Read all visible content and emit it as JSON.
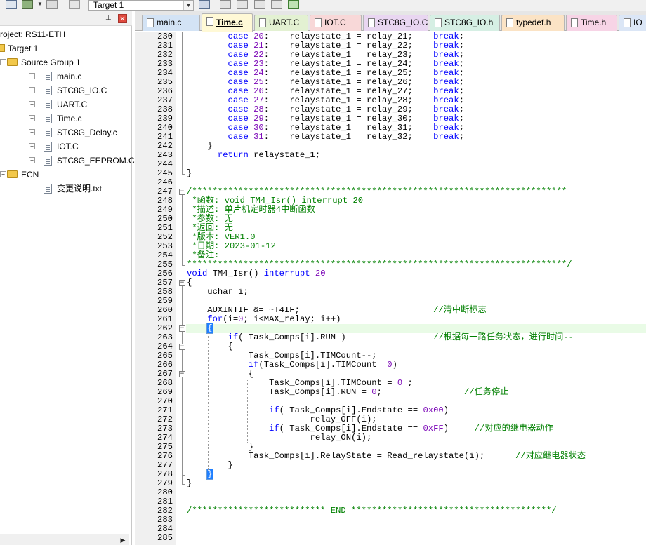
{
  "toolbar": {
    "target_select_value": "Target 1"
  },
  "project_panel": {
    "pin_glyph": "⊥",
    "close_glyph": "✕",
    "tree": [
      {
        "label": "roject: RS11-ETH",
        "kind": "project",
        "indent": 0
      },
      {
        "label": "Target 1",
        "kind": "target",
        "indent": 1
      },
      {
        "label": "Source Group 1",
        "kind": "folder",
        "indent": 2
      },
      {
        "label": "main.c",
        "kind": "file",
        "indent": 3
      },
      {
        "label": "STC8G_IO.C",
        "kind": "file",
        "indent": 3
      },
      {
        "label": "UART.C",
        "kind": "file",
        "indent": 3
      },
      {
        "label": "Time.c",
        "kind": "file",
        "indent": 3
      },
      {
        "label": "STC8G_Delay.c",
        "kind": "file",
        "indent": 3
      },
      {
        "label": "IOT.C",
        "kind": "file",
        "indent": 3
      },
      {
        "label": "STC8G_EEPROM.C",
        "kind": "file",
        "indent": 3
      },
      {
        "label": "ECN",
        "kind": "folder",
        "indent": 2
      },
      {
        "label": "变更说明.txt",
        "kind": "file",
        "indent": 3
      }
    ]
  },
  "tabs": [
    {
      "label": "main.c",
      "color": "#d3e3f5",
      "active": false
    },
    {
      "label": "Time.c",
      "color": "#fff9d6",
      "active": true
    },
    {
      "label": "UART.C",
      "color": "#e3f1d2",
      "active": false
    },
    {
      "label": "IOT.C",
      "color": "#f8d8d8",
      "active": false
    },
    {
      "label": "STC8G_IO.C",
      "color": "#e9d6f1",
      "active": false
    },
    {
      "label": "STC8G_IO.h",
      "color": "#d6efe4",
      "active": false
    },
    {
      "label": "typedef.h",
      "color": "#fbe3c5",
      "active": false
    },
    {
      "label": "Time.h",
      "color": "#f7d4e6",
      "active": false
    },
    {
      "label": "IO",
      "color": "#dbe6f6",
      "active": false
    }
  ],
  "code": {
    "highlight_line": 262,
    "lines": [
      {
        "n": "230",
        "segs": [
          [
            "        ",
            ""
          ],
          [
            "case",
            "kw"
          ],
          [
            " ",
            ""
          ],
          [
            "20",
            "num"
          ],
          [
            ":    relaystate_1 = relay_21;    ",
            ""
          ],
          [
            "break",
            "kw"
          ],
          [
            ";",
            ""
          ]
        ]
      },
      {
        "n": "231",
        "segs": [
          [
            "        ",
            ""
          ],
          [
            "case",
            "kw"
          ],
          [
            " ",
            ""
          ],
          [
            "21",
            "num"
          ],
          [
            ":    relaystate_1 = relay_22;    ",
            ""
          ],
          [
            "break",
            "kw"
          ],
          [
            ";",
            ""
          ]
        ]
      },
      {
        "n": "232",
        "segs": [
          [
            "        ",
            ""
          ],
          [
            "case",
            "kw"
          ],
          [
            " ",
            ""
          ],
          [
            "22",
            "num"
          ],
          [
            ":    relaystate_1 = relay_23;    ",
            ""
          ],
          [
            "break",
            "kw"
          ],
          [
            ";",
            ""
          ]
        ]
      },
      {
        "n": "233",
        "segs": [
          [
            "        ",
            ""
          ],
          [
            "case",
            "kw"
          ],
          [
            " ",
            ""
          ],
          [
            "23",
            "num"
          ],
          [
            ":    relaystate_1 = relay_24;    ",
            ""
          ],
          [
            "break",
            "kw"
          ],
          [
            ";",
            ""
          ]
        ]
      },
      {
        "n": "234",
        "segs": [
          [
            "        ",
            ""
          ],
          [
            "case",
            "kw"
          ],
          [
            " ",
            ""
          ],
          [
            "24",
            "num"
          ],
          [
            ":    relaystate_1 = relay_25;    ",
            ""
          ],
          [
            "break",
            "kw"
          ],
          [
            ";",
            ""
          ]
        ]
      },
      {
        "n": "235",
        "segs": [
          [
            "        ",
            ""
          ],
          [
            "case",
            "kw"
          ],
          [
            " ",
            ""
          ],
          [
            "25",
            "num"
          ],
          [
            ":    relaystate_1 = relay_26;    ",
            ""
          ],
          [
            "break",
            "kw"
          ],
          [
            ";",
            ""
          ]
        ]
      },
      {
        "n": "236",
        "segs": [
          [
            "        ",
            ""
          ],
          [
            "case",
            "kw"
          ],
          [
            " ",
            ""
          ],
          [
            "26",
            "num"
          ],
          [
            ":    relaystate_1 = relay_27;    ",
            ""
          ],
          [
            "break",
            "kw"
          ],
          [
            ";",
            ""
          ]
        ]
      },
      {
        "n": "237",
        "segs": [
          [
            "        ",
            ""
          ],
          [
            "case",
            "kw"
          ],
          [
            " ",
            ""
          ],
          [
            "27",
            "num"
          ],
          [
            ":    relaystate_1 = relay_28;    ",
            ""
          ],
          [
            "break",
            "kw"
          ],
          [
            ";",
            ""
          ]
        ]
      },
      {
        "n": "238",
        "segs": [
          [
            "        ",
            ""
          ],
          [
            "case",
            "kw"
          ],
          [
            " ",
            ""
          ],
          [
            "28",
            "num"
          ],
          [
            ":    relaystate_1 = relay_29;    ",
            ""
          ],
          [
            "break",
            "kw"
          ],
          [
            ";",
            ""
          ]
        ]
      },
      {
        "n": "239",
        "segs": [
          [
            "        ",
            ""
          ],
          [
            "case",
            "kw"
          ],
          [
            " ",
            ""
          ],
          [
            "29",
            "num"
          ],
          [
            ":    relaystate_1 = relay_30;    ",
            ""
          ],
          [
            "break",
            "kw"
          ],
          [
            ";",
            ""
          ]
        ]
      },
      {
        "n": "240",
        "segs": [
          [
            "        ",
            ""
          ],
          [
            "case",
            "kw"
          ],
          [
            " ",
            ""
          ],
          [
            "30",
            "num"
          ],
          [
            ":    relaystate_1 = relay_31;    ",
            ""
          ],
          [
            "break",
            "kw"
          ],
          [
            ";",
            ""
          ]
        ]
      },
      {
        "n": "241",
        "segs": [
          [
            "        ",
            ""
          ],
          [
            "case",
            "kw"
          ],
          [
            " ",
            ""
          ],
          [
            "31",
            "num"
          ],
          [
            ":    relaystate_1 = relay_32;    ",
            ""
          ],
          [
            "break",
            "kw"
          ],
          [
            ";",
            ""
          ]
        ]
      },
      {
        "n": "242",
        "segs": [
          [
            "    }",
            ""
          ]
        ]
      },
      {
        "n": "243",
        "segs": [
          [
            "      ",
            ""
          ],
          [
            "return",
            "kw"
          ],
          [
            " relaystate_1;",
            ""
          ]
        ]
      },
      {
        "n": "244",
        "segs": []
      },
      {
        "n": "245",
        "segs": [
          [
            "}",
            ""
          ]
        ]
      },
      {
        "n": "246",
        "segs": []
      },
      {
        "n": "247",
        "segs": [
          [
            "/*************************************************************************",
            "cm"
          ]
        ]
      },
      {
        "n": "248",
        "segs": [
          [
            " *函数: void TM4_Isr() interrupt 20",
            "cm"
          ]
        ]
      },
      {
        "n": "249",
        "segs": [
          [
            " *描述: 单片机定时器4中断函数",
            "cm"
          ]
        ]
      },
      {
        "n": "250",
        "segs": [
          [
            " *参数: 无",
            "cm"
          ]
        ]
      },
      {
        "n": "251",
        "segs": [
          [
            " *返回: 无",
            "cm"
          ]
        ]
      },
      {
        "n": "252",
        "segs": [
          [
            " *版本: VER1.0",
            "cm"
          ]
        ]
      },
      {
        "n": "253",
        "segs": [
          [
            " *日期: 2023-01-12",
            "cm"
          ]
        ]
      },
      {
        "n": "254",
        "segs": [
          [
            " *备注:",
            "cm"
          ]
        ]
      },
      {
        "n": "255",
        "segs": [
          [
            "**************************************************************************/",
            "cm"
          ]
        ]
      },
      {
        "n": "256",
        "segs": [
          [
            "void",
            "kw"
          ],
          [
            " TM4_Isr() ",
            ""
          ],
          [
            "interrupt",
            "kw"
          ],
          [
            " ",
            ""
          ],
          [
            "20",
            "num"
          ]
        ]
      },
      {
        "n": "257",
        "segs": [
          [
            "{",
            ""
          ]
        ]
      },
      {
        "n": "258",
        "segs": [
          [
            "    uchar i;",
            ""
          ]
        ]
      },
      {
        "n": "259",
        "segs": []
      },
      {
        "n": "260",
        "segs": [
          [
            "    AUXINTIF &= ~T4IF;                          ",
            ""
          ],
          [
            "//清中断标志",
            "cm"
          ]
        ]
      },
      {
        "n": "261",
        "segs": [
          [
            "    ",
            ""
          ],
          [
            "for",
            "kw"
          ],
          [
            "(i=",
            ""
          ],
          [
            "0",
            "num"
          ],
          [
            "; i<MAX_relay; i++)",
            ""
          ]
        ]
      },
      {
        "n": "262",
        "segs": [
          [
            "    ",
            ""
          ],
          [
            "{",
            "brace-hl"
          ]
        ]
      },
      {
        "n": "263",
        "segs": [
          [
            "        ",
            ""
          ],
          [
            "if",
            "kw"
          ],
          [
            "( Task_Comps[i].RUN )                 ",
            ""
          ],
          [
            "//根据每一路任务状态，进行时间--",
            "cm"
          ]
        ]
      },
      {
        "n": "264",
        "segs": [
          [
            "        {",
            ""
          ]
        ]
      },
      {
        "n": "265",
        "segs": [
          [
            "            Task_Comps[i].TIMCount--;",
            ""
          ]
        ]
      },
      {
        "n": "266",
        "segs": [
          [
            "            ",
            ""
          ],
          [
            "if",
            "kw"
          ],
          [
            "(Task_Comps[i].TIMCount==",
            ""
          ],
          [
            "0",
            "num"
          ],
          [
            ")",
            ""
          ]
        ]
      },
      {
        "n": "267",
        "segs": [
          [
            "            {",
            ""
          ]
        ]
      },
      {
        "n": "268",
        "segs": [
          [
            "                Task_Comps[i].TIMCount = ",
            ""
          ],
          [
            "0",
            "num"
          ],
          [
            " ;",
            ""
          ]
        ]
      },
      {
        "n": "269",
        "segs": [
          [
            "                Task_Comps[i].RUN = ",
            ""
          ],
          [
            "0",
            "num"
          ],
          [
            ";                ",
            ""
          ],
          [
            "//任务停止",
            "cm"
          ]
        ]
      },
      {
        "n": "270",
        "segs": []
      },
      {
        "n": "271",
        "segs": [
          [
            "                ",
            ""
          ],
          [
            "if",
            "kw"
          ],
          [
            "( Task_Comps[i].Endstate == ",
            ""
          ],
          [
            "0x00",
            "num"
          ],
          [
            ")",
            ""
          ]
        ]
      },
      {
        "n": "272",
        "segs": [
          [
            "                        relay_OFF(i);",
            ""
          ]
        ]
      },
      {
        "n": "273",
        "segs": [
          [
            "                ",
            ""
          ],
          [
            "if",
            "kw"
          ],
          [
            "( Task_Comps[i].Endstate == ",
            ""
          ],
          [
            "0xFF",
            "num"
          ],
          [
            ")     ",
            ""
          ],
          [
            "//对应的继电器动作",
            "cm"
          ]
        ]
      },
      {
        "n": "274",
        "segs": [
          [
            "                        relay_ON(i);",
            ""
          ]
        ]
      },
      {
        "n": "275",
        "segs": [
          [
            "            }",
            ""
          ]
        ]
      },
      {
        "n": "276",
        "segs": [
          [
            "            Task_Comps[i].RelayState = Read_relaystate(i);      ",
            ""
          ],
          [
            "//对应继电器状态",
            "cm"
          ]
        ]
      },
      {
        "n": "277",
        "segs": [
          [
            "        }",
            ""
          ]
        ]
      },
      {
        "n": "278",
        "segs": [
          [
            "    ",
            ""
          ],
          [
            "}",
            "brace-hl"
          ]
        ]
      },
      {
        "n": "279",
        "segs": [
          [
            "}",
            ""
          ]
        ]
      },
      {
        "n": "280",
        "segs": []
      },
      {
        "n": "281",
        "segs": []
      },
      {
        "n": "282",
        "segs": [
          [
            "/************************** END ***************************************/",
            "cm"
          ]
        ]
      },
      {
        "n": "283",
        "segs": []
      },
      {
        "n": "284",
        "segs": []
      },
      {
        "n": "285",
        "segs": []
      }
    ]
  }
}
